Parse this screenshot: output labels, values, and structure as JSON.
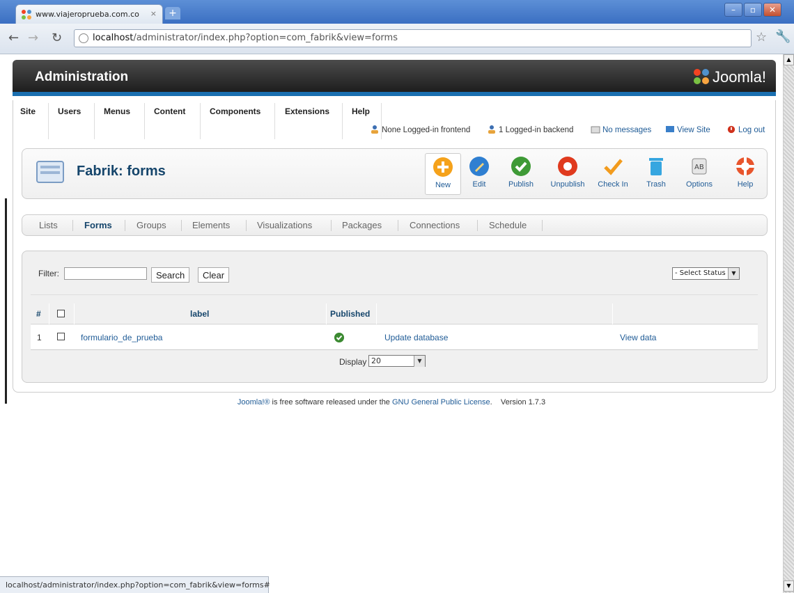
{
  "browser": {
    "tab_title": "www.viajeroprueba.com.co - ...",
    "tab_close": "×",
    "new_tab": "+",
    "url_host": "localhost",
    "url_path": "/administrator/index.php?option=com_fabrik&view=forms",
    "status_url": "localhost/administrator/index.php?option=com_fabrik&view=forms#"
  },
  "header": {
    "title": "Administration",
    "logo_text": "Joomla!"
  },
  "menu": {
    "items": [
      "Site",
      "Users",
      "Menus",
      "Content",
      "Components",
      "Extensions",
      "Help"
    ]
  },
  "status": {
    "frontend": "None Logged-in frontend",
    "backend": "1 Logged-in backend",
    "messages": "No messages",
    "view_site": "View Site",
    "logout": "Log out"
  },
  "page": {
    "title": "Fabrik: forms"
  },
  "toolbar": {
    "new": "New",
    "edit": "Edit",
    "publish": "Publish",
    "unpublish": "Unpublish",
    "checkin": "Check In",
    "trash": "Trash",
    "options": "Options",
    "help": "Help"
  },
  "subnav": {
    "items": [
      "Lists",
      "Forms",
      "Groups",
      "Elements",
      "Visualizations",
      "Packages",
      "Connections",
      "Schedule"
    ]
  },
  "filter": {
    "label": "Filter:",
    "value": "",
    "search": "Search",
    "clear": "Clear",
    "status_select": "- Select Status -"
  },
  "grid": {
    "headers": {
      "num": "#",
      "label": "label",
      "published": "Published"
    },
    "rows": [
      {
        "num": "1",
        "label": "formulario_de_prueba",
        "action": "Update database",
        "view": "View data"
      }
    ],
    "display_label": "Display #",
    "display_value": "20"
  },
  "footer": {
    "joomla": "Joomla!®",
    "text1": " is free software released under the ",
    "license": "GNU General Public License",
    "version": ".    Version 1.7.3"
  },
  "colors": {
    "accent": "#1a6fb0",
    "title_blue": "#15456b",
    "link_blue": "#1f5b96",
    "published_green": "#3c8a32"
  }
}
